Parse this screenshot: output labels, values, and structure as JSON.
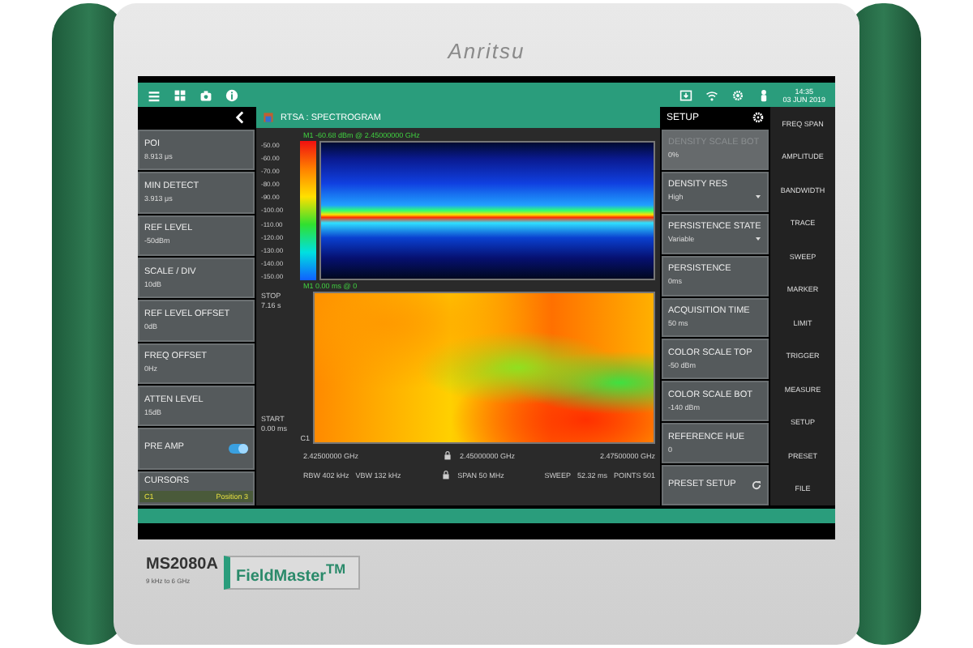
{
  "device": {
    "brand": "Anritsu",
    "model": "MS2080A",
    "range": "9 kHz to 6 GHz",
    "series": "FieldMaster$^{TM}$"
  },
  "status_bar": {
    "time": "14:35",
    "date": "03 JUN 2019"
  },
  "view_title": "RTSA : SPECTROGRAM",
  "left_panel": [
    {
      "kind": "value",
      "label": "POI",
      "value": "8.913 μs"
    },
    {
      "kind": "value",
      "label": "MIN DETECT",
      "value": "3.913 μs"
    },
    {
      "kind": "value",
      "label": "REF LEVEL",
      "value": "-50dBm"
    },
    {
      "kind": "value",
      "label": "SCALE / DIV",
      "value": "10dB"
    },
    {
      "kind": "value",
      "label": "REF LEVEL OFFSET",
      "value": "0dB"
    },
    {
      "kind": "value",
      "label": "FREQ OFFSET",
      "value": "0Hz"
    },
    {
      "kind": "value",
      "label": "ATTEN LEVEL",
      "value": "15dB"
    },
    {
      "kind": "toggle",
      "label": "PRE AMP",
      "on": true
    },
    {
      "kind": "cursor",
      "label": "CURSORS",
      "cursor": "C1",
      "position": "Position 3"
    }
  ],
  "spectrum": {
    "marker_readout": "M1 -60.68 dBm @ 2.45000000 GHz",
    "y_labels": [
      "-50.00",
      "-60.00",
      "-70.00",
      "-80.00",
      "-90.00",
      "-100.00",
      "-110.00",
      "-120.00",
      "-130.00",
      "-140.00",
      "-150.00"
    ]
  },
  "spectrogram": {
    "marker_readout": "M1 0.00 ms @ 0",
    "stop_label": "STOP",
    "stop_value": "7.16 s",
    "start_label": "START",
    "start_value": "0.00 ms",
    "cursor_label": "C1"
  },
  "freq_axis": [
    "2.42500000 GHz",
    "2.45000000 GHz",
    "2.47500000 GHz"
  ],
  "info": {
    "rbw": "RBW 402 kHz",
    "vbw": "VBW 132 kHz",
    "span": "SPAN 50 MHz",
    "sweep_label": "SWEEP",
    "sweep": "52.32 ms",
    "points": "POINTS 501"
  },
  "setup": {
    "title": "SETUP",
    "items": [
      {
        "kind": "value",
        "label": "DENSITY SCALE BOT",
        "value": "0%",
        "disabled": true
      },
      {
        "kind": "dropdown",
        "label": "DENSITY RES",
        "value": "High",
        "disabled": false
      },
      {
        "kind": "dropdown",
        "label": "PERSISTENCE STATE",
        "value": "Variable",
        "disabled": false
      },
      {
        "kind": "value",
        "label": "PERSISTENCE",
        "value": "0ms",
        "disabled": false
      },
      {
        "kind": "value",
        "label": "ACQUISITION TIME",
        "value": "50 ms",
        "disabled": false
      },
      {
        "kind": "value",
        "label": "COLOR SCALE TOP",
        "value": "-50 dBm",
        "disabled": false
      },
      {
        "kind": "value",
        "label": "COLOR SCALE BOT",
        "value": "-140 dBm",
        "disabled": false
      },
      {
        "kind": "value",
        "label": "REFERENCE HUE",
        "value": "0",
        "disabled": false
      },
      {
        "kind": "button",
        "label": "PRESET SETUP",
        "disabled": false
      }
    ]
  },
  "softkeys": [
    "FREQ SPAN",
    "AMPLITUDE",
    "BANDWIDTH",
    "TRACE",
    "SWEEP",
    "MARKER",
    "LIMIT",
    "TRIGGER",
    "MEASURE",
    "SETUP",
    "PRESET",
    "FILE"
  ]
}
